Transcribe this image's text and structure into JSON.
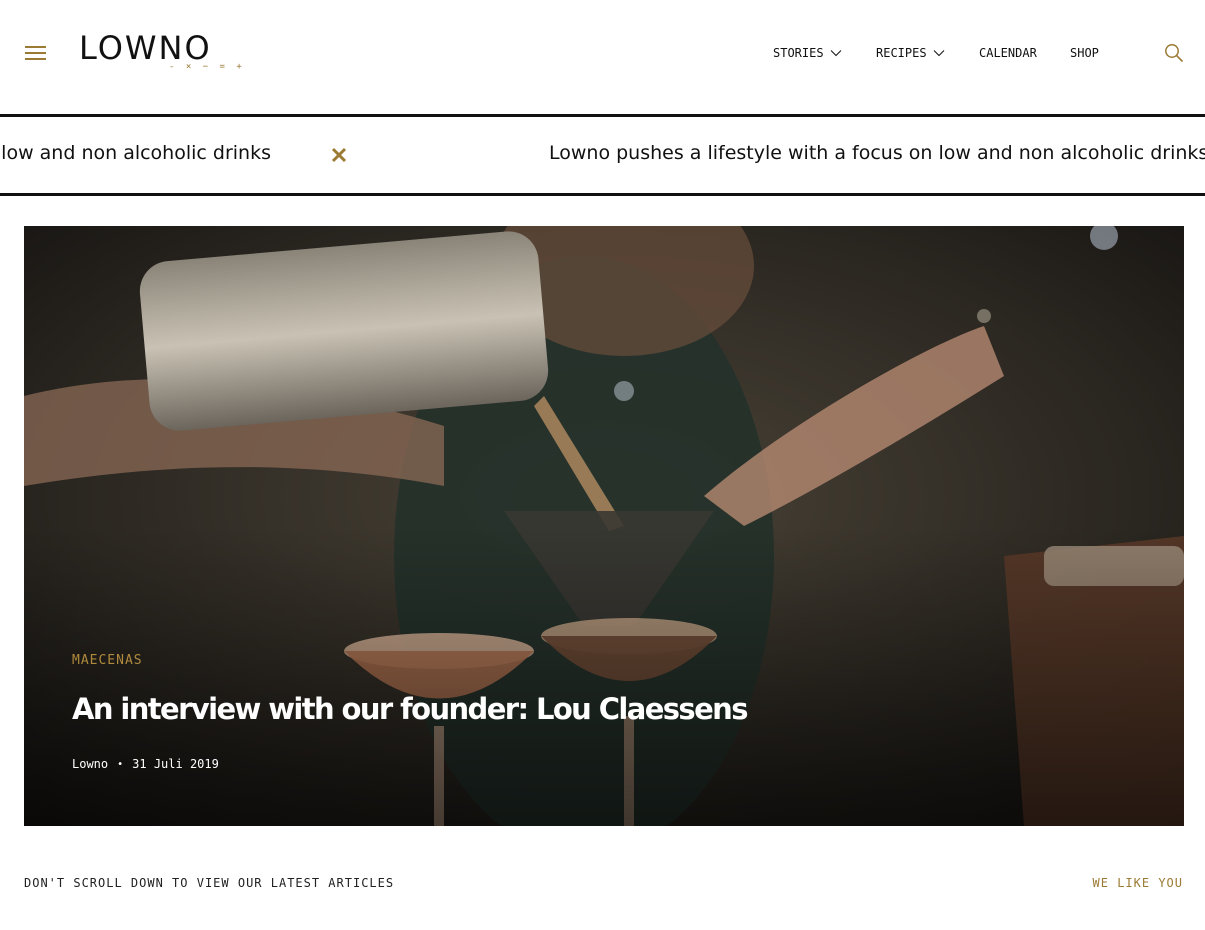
{
  "header": {
    "logo_text": "LOWNO",
    "logo_sub": "- × − = +",
    "nav": {
      "stories": "STORIES",
      "recipes": "RECIPES",
      "calendar": "CALENDAR",
      "shop": "SHOP"
    },
    "icons": {
      "menu": "hamburger-icon",
      "search": "search-icon",
      "dropdown": "chevron-down-icon"
    }
  },
  "ticker": {
    "text_left": "Lowno pushes a lifestyle with a focus on low and non alcoholic drinks",
    "text_right": "Lowno pushes a lifestyle with a focus on low and non alcoholic drinks",
    "separator_icon": "cross-icon"
  },
  "hero": {
    "category": "MAECENAS",
    "title": "An interview with our founder: Lou Claessens",
    "author": "Lowno",
    "separator": "•",
    "date": "31 Juli 2019"
  },
  "footer": {
    "left_text": "DON'T SCROLL DOWN TO VIEW OUR LATEST ARTICLES",
    "right_text": "WE LIKE YOU"
  },
  "colors": {
    "accent": "#9b7a33",
    "text": "#111111",
    "background": "#ffffff"
  }
}
